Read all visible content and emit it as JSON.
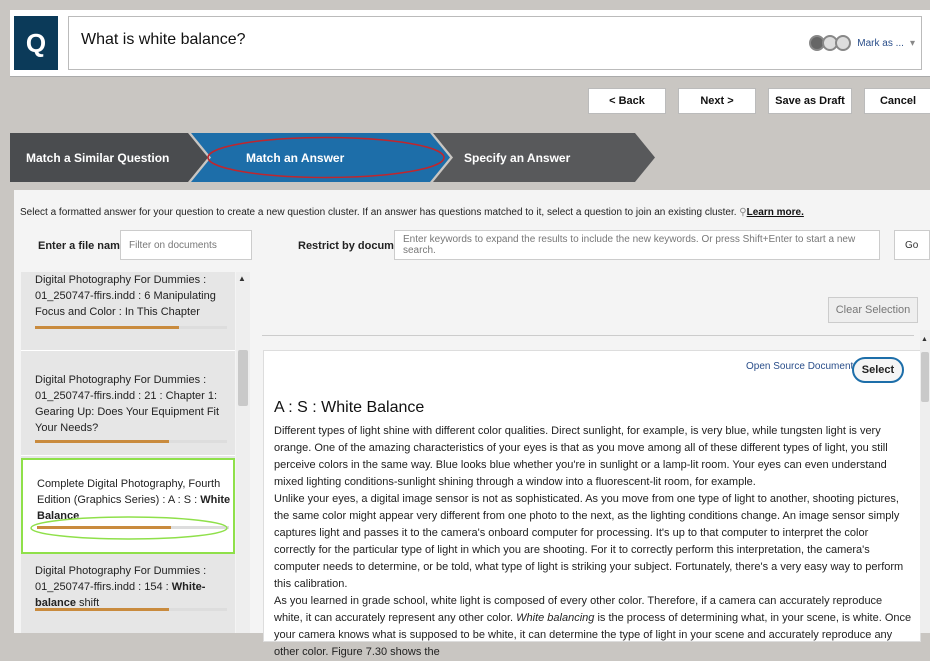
{
  "header": {
    "logo": "Q",
    "question": "What is white balance?",
    "mark_as": "Mark as ...",
    "mark_caret": "▾"
  },
  "toolbar": {
    "back": "< Back",
    "next": "Next >",
    "save_draft": "Save as Draft",
    "cancel": "Cancel"
  },
  "wizard": {
    "steps": [
      "Match a Similar Question",
      "Match an Answer",
      "Specify an Answer"
    ],
    "active_step": 1
  },
  "intro": {
    "text": "Select a formatted answer for your question to create a new question cluster. If an answer has questions matched to it, select a question to join an existing cluster.",
    "learn_more": "Learn more."
  },
  "filters": {
    "file_label": "Enter a file name:",
    "file_placeholder": "Filter on documents",
    "restrict_label": "Restrict by document:",
    "restrict_placeholder": "Enter keywords to expand the results to include the new keywords. Or press Shift+Enter to start a new search.",
    "go": "Go"
  },
  "results": [
    {
      "text": "Digital Photography For Dummies : 01_250747-ffirs.indd : 6 Manipulating Focus and Color : In This Chapter",
      "score": 0.75
    },
    {
      "text": "Digital Photography For Dummies : 01_250747-ffirs.indd : 21 : Chapter 1: Gearing Up: Does Your Equipment Fit Your Needs?",
      "score": 0.7
    },
    {
      "text_pre": "Complete Digital Photography, Fourth Edition (Graphics Series) : A : S : ",
      "text_bold": "White Balance",
      "score": 0.7,
      "selected": true
    },
    {
      "text_pre": "Digital Photography For Dummies : 01_250747-ffirs.indd : 154 : ",
      "text_bold": "White-balance",
      "text_post": " shift",
      "score": 0.7
    }
  ],
  "answer": {
    "clear_selection": "Clear Selection",
    "open_source": "Open Source Document",
    "select": "Select",
    "title": "A : S : White Balance",
    "p1": "Different types of light shine with different color qualities. Direct sunlight, for example, is very blue, while tungsten light is very orange. One of the amazing characteristics of your eyes is that as you move among all of these different types of light, you still perceive colors in the same way. Blue looks blue whether you're in sunlight or a lamp-lit room. Your eyes can even understand mixed lighting conditions-sunlight shining through a window into a fluorescent-lit room, for example.",
    "p2": "Unlike your eyes, a digital image sensor is not as sophisticated. As you move from one type of light to another, shooting pictures, the same color might appear very different from one photo to the next, as the lighting conditions change. An image sensor simply captures light and passes it to the camera's onboard computer for processing. It's up to that computer to interpret the color correctly for the particular type of light in which you are shooting. For it to correctly perform this interpretation, the camera's computer needs to determine, or be told, what type of light is striking your subject. Fortunately, there's a very easy way to perform this calibration.",
    "p3_pre": "As you learned in grade school, white light is composed of every other color. Therefore, if a camera can accurately reproduce white, it can accurately represent any other color. ",
    "p3_em": "White balancing",
    "p3_post": " is the process of determining what, in your scene, is white. Once your camera knows what is supposed to be white, it can determine the type of light in your scene and accurately reproduce any other color. Figure 7.30 shows the"
  },
  "colors": {
    "logo_bg": "#0b3a59",
    "wizard_dark": "#4a4c4f",
    "wizard_active": "#1d6ea9",
    "score_bar": "#c98b3e",
    "highlight_red": "#c0262d",
    "highlight_green": "#8fe04a"
  }
}
